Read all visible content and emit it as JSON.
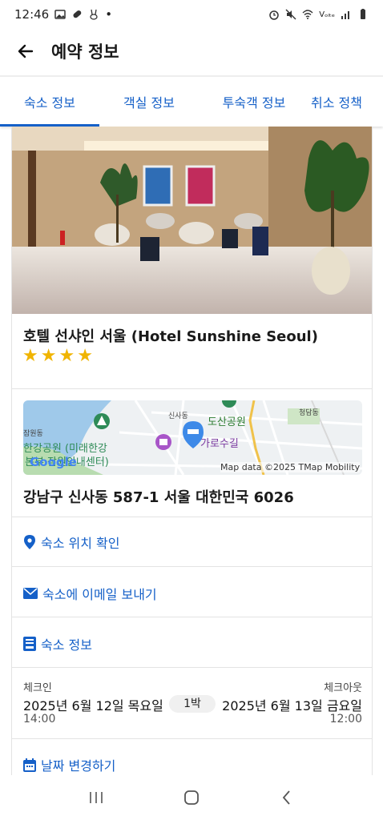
{
  "status_bar": {
    "time": "12:46",
    "dot": "•",
    "network": "Vₒₗₜₑ"
  },
  "app_bar": {
    "title": "예약 정보"
  },
  "tabs": [
    {
      "label": "숙소 정보",
      "active": true
    },
    {
      "label": "객실 정보",
      "active": false
    },
    {
      "label": "투숙객 정보",
      "active": false
    },
    {
      "label": "취소 정책",
      "active": false
    }
  ],
  "hotel": {
    "name": "호텔 선샤인 서울 (Hotel Sunshine Seoul)",
    "star_rating": 4,
    "address": "강남구 신사동 587-1 서울 대한민국 6026"
  },
  "map": {
    "labels": {
      "park": "도산공원",
      "sinsa": "신사동",
      "cheongdam": "청담동",
      "garosu": "가로수길",
      "hangang": "한강공원 (미래한강",
      "hangang2": "본부 잠원안내센터)",
      "jamwon": "잠원동",
      "attribution": "Map data ©2025 TMap Mobility",
      "google": "Google"
    }
  },
  "links": {
    "location": "숙소 위치 확인",
    "email": "숙소에 이메일 보내기",
    "info": "숙소 정보",
    "change_dates": "날짜 변경하기"
  },
  "stay": {
    "checkin_label": "체크인",
    "checkout_label": "체크아웃",
    "checkin_date": "2025년 6월 12일 목요일",
    "checkout_date": "2025년 6월 13일 금요일",
    "nights": "1박",
    "checkin_time": "14:00",
    "checkout_time": "12:00"
  },
  "colors": {
    "accent": "#1560c8",
    "star": "#f0b400"
  }
}
